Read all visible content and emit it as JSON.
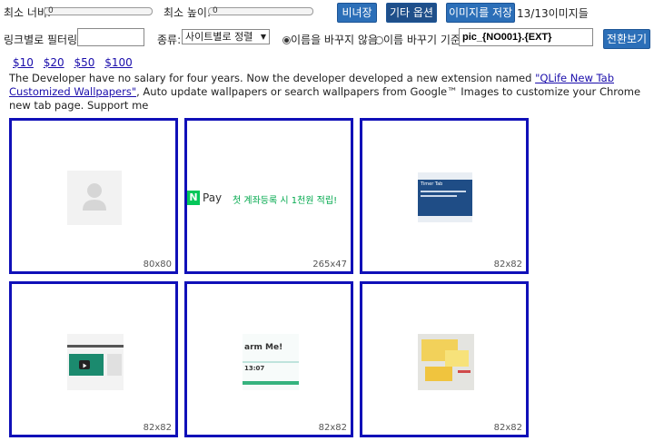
{
  "toolbar": {
    "min_width_label": "최소 너비:",
    "min_width_value": "0",
    "min_height_label": "최소 높이:",
    "min_height_value": "0",
    "btn_ratio": "비녀장",
    "btn_more_options": "기타 옵션",
    "btn_save_images": "이미지를 저장",
    "image_count": "13/13이미지들"
  },
  "filter_row": {
    "filter_label": "링크별로 필터링:",
    "filter_value": "",
    "sort_label": "종류:",
    "sort_selected": "사이트별로 정렬",
    "radio_keep_name": "이름을 바꾸지 않음",
    "radio_rename": "이름 바꾸기 기준",
    "rename_pattern": "pic_{NO001}.{EXT}",
    "btn_switch": "전환보기"
  },
  "donation": {
    "amounts": [
      "$10",
      "$20",
      "$50",
      "$100"
    ],
    "text_before": "The Developer have no salary for four years. Now the developer developed a new extension named ",
    "link_text": "\"QLife New Tab Customized Wallpapers\"",
    "text_after": ", Auto update wallpapers or search wallpapers from Google™ Images to customize your Chrome new tab page. Support me"
  },
  "images": [
    {
      "size": "80x80",
      "kind": "avatar-placeholder"
    },
    {
      "size": "265x47",
      "kind": "banner",
      "pay_text": "Pay",
      "banner_text": "첫 계좌등록 시 1천원 적립!"
    },
    {
      "size": "82x82",
      "kind": "screenshot-blue",
      "thumb_title": "Timer Tab"
    },
    {
      "size": "82x82",
      "kind": "screenshot-video"
    },
    {
      "size": "82x82",
      "kind": "screenshot-alarm",
      "alarm_text": "arm Me!",
      "clock_text": "13:07"
    },
    {
      "size": "82x82",
      "kind": "photo-notes"
    }
  ],
  "colors": {
    "accent": "#2c6fb8",
    "card_border": "#1010b8",
    "link": "#1a0dab",
    "naver_green": "#03c75a"
  }
}
